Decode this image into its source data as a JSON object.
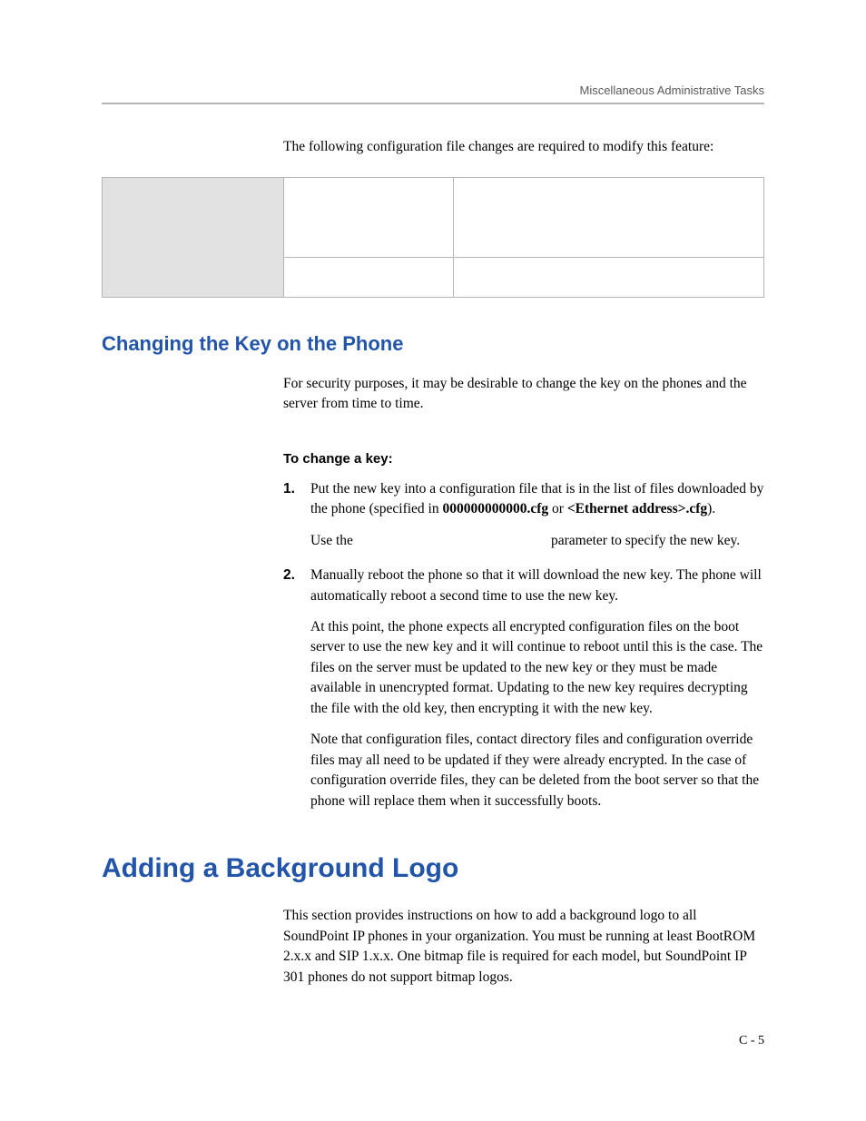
{
  "header": {
    "running_title": "Miscellaneous Administrative Tasks"
  },
  "intro": "The following configuration file changes are required to modify this feature:",
  "section1": {
    "title": "Changing the Key on the Phone",
    "para1": "For security purposes, it may be desirable to change the key on the phones and the server from time to time.",
    "subhead": "To change a key:",
    "steps": {
      "step1": {
        "part1": "Put the new key into a configuration file that is in the list of files downloaded by the phone (specified in ",
        "bold1": "000000000000.cfg",
        "mid1": " or ",
        "bold2": "<Ethernet address>.cfg",
        "part2": ").",
        "sub_a": "Use the",
        "sub_b": "parameter to specify the new key."
      },
      "step2": {
        "para1": "Manually reboot the phone so that it will download the new key. The phone will automatically reboot a second time to use the new key.",
        "para2": "At this point, the phone expects all encrypted configuration files on the boot server to use the new key and it will continue to reboot until this is the case. The files on the server must be updated to the new key or they must be made available in unencrypted format. Updating to the new key requires decrypting the file with the old key, then encrypting it with the new key.",
        "para3": "Note that configuration files, contact directory files and configuration override files may all need to be updated if they were already encrypted. In the case of configuration override files, they can be deleted from the boot server so that the phone will replace them when it successfully boots."
      }
    }
  },
  "section2": {
    "title": "Adding a Background Logo",
    "para1": "This section provides instructions on how to add a background logo to all SoundPoint IP phones in your organization. You must be running at least BootROM 2.x.x and SIP 1.x.x. One bitmap file is required for each model, but SoundPoint IP 301 phones do not support bitmap logos."
  },
  "footer": {
    "page_number": "C - 5"
  }
}
